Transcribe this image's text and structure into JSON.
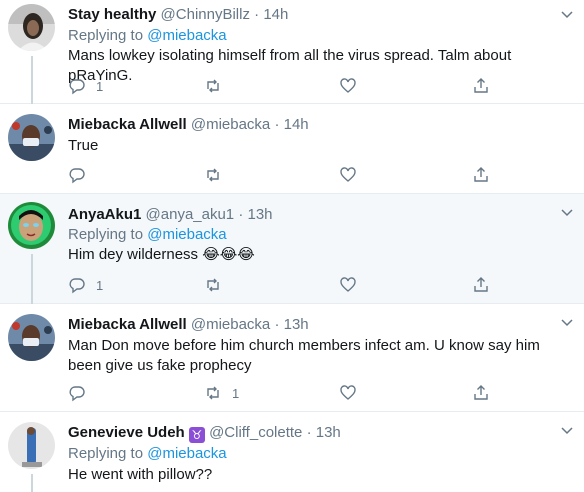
{
  "tweets": [
    {
      "name": "Stay healthy",
      "handle": "@ChinnyBillz",
      "dot": "·",
      "time": "14h",
      "reply_prefix": "Replying to ",
      "reply_to": "@miebacka",
      "text": "Mans lowkey isolating himself from all the virus spread. Talm about pRaYinG.",
      "reply_count": "1",
      "retweet_count": ""
    },
    {
      "name": "Miebacka Allwell",
      "handle": "@miebacka",
      "dot": "·",
      "time": "14h",
      "text": "True",
      "reply_count": "",
      "retweet_count": ""
    },
    {
      "name": "AnyaAku1",
      "handle": "@anya_aku1",
      "dot": "·",
      "time": "13h",
      "reply_prefix": "Replying to ",
      "reply_to": "@miebacka",
      "text": "Him dey wilderness 😂😂😂",
      "reply_count": "1",
      "retweet_count": ""
    },
    {
      "name": "Miebacka Allwell",
      "handle": "@miebacka",
      "dot": "·",
      "time": "13h",
      "text": "Man Don move before him church members infect am. U know say him been give us fake prophecy",
      "reply_count": "",
      "retweet_count": "1"
    },
    {
      "name": "Genevieve Udeh",
      "name_badge": "♉",
      "handle": "@Cliff_colette",
      "dot": "·",
      "time": "13h",
      "reply_prefix": "Replying to ",
      "reply_to": "@miebacka",
      "text": "He went with pillow??"
    }
  ],
  "icons": {
    "reply": "reply-icon",
    "retweet": "retweet-icon",
    "like": "heart-icon",
    "share": "share-icon",
    "more": "chevron-down-icon"
  },
  "colors": {
    "link": "#1b95e0",
    "muted": "#657786",
    "divider": "#e6ecf0",
    "highlight_bg": "#f5f8fa"
  }
}
